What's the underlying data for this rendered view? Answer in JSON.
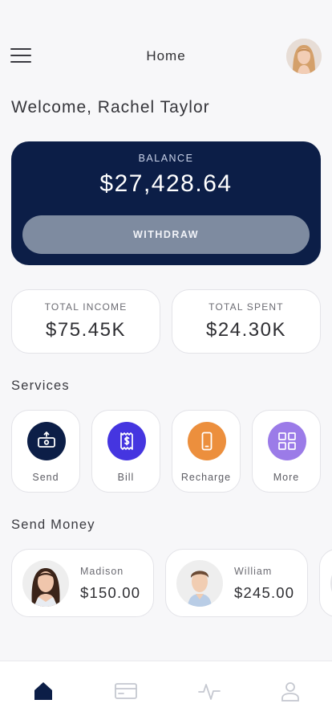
{
  "header": {
    "title": "Home"
  },
  "welcome": {
    "text": "Welcome, Rachel Taylor"
  },
  "balance": {
    "label": "BALANCE",
    "amount": "$27,428.64",
    "withdraw_label": "WITHDRAW"
  },
  "stats": {
    "income": {
      "label": "TOTAL INCOME",
      "value": "$75.45K"
    },
    "spent": {
      "label": "TOTAL SPENT",
      "value": "$24.30K"
    }
  },
  "services": {
    "title": "Services",
    "items": [
      {
        "label": "Send",
        "icon": "send-money-icon",
        "color": "#0c1e47"
      },
      {
        "label": "Bill",
        "icon": "bill-receipt-icon",
        "color": "#4535e0"
      },
      {
        "label": "Recharge",
        "icon": "phone-icon",
        "color": "#ec8f3d"
      },
      {
        "label": "More",
        "icon": "grid-icon",
        "color": "#9b7be8"
      }
    ]
  },
  "send_money": {
    "title": "Send Money",
    "contacts": [
      {
        "name": "Madison",
        "amount": "$150.00"
      },
      {
        "name": "William",
        "amount": "$245.00"
      }
    ]
  },
  "nav": {
    "items": [
      "home-icon",
      "card-icon",
      "activity-icon",
      "profile-icon"
    ],
    "active_color": "#0c1e47",
    "inactive_color": "#c5c8d0"
  }
}
